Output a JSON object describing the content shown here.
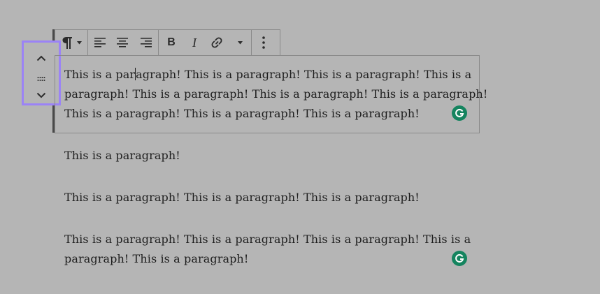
{
  "toolbar": {
    "paragraph_icon": "pilcrow-icon",
    "align_left": "align-left-icon",
    "align_center": "align-center-icon",
    "align_right": "align-right-icon",
    "bold_label": "B",
    "italic_label": "I",
    "link_icon": "link-icon",
    "more_rich_text": "chevron-down-icon",
    "more_options": "vertical-ellipsis-icon"
  },
  "mover": {
    "up_icon": "chevron-up-icon",
    "drag_icon": "drag-handle-icon",
    "down_icon": "chevron-down-icon",
    "highlight_color": "#9b83f6"
  },
  "blocks": {
    "selected": {
      "line1_before_caret": "This is a par",
      "line1_after_caret": "agraph! This is a paragraph! This is a paragraph! This is a",
      "line2": "paragraph! This is a paragraph! This is a paragraph! This is a paragraph!",
      "line3": "This is a paragraph! This is a paragraph! This is a paragraph!"
    },
    "second": "This is a paragraph!",
    "third": "This is a paragraph! This is a paragraph! This is a paragraph!",
    "fourth": {
      "line1": "This is a paragraph! This is a paragraph! This is a paragraph! This is a",
      "line2": "paragraph! This is a paragraph!"
    }
  },
  "grammarly": {
    "icon": "grammarly-icon",
    "letter": "G",
    "color": "#15845f"
  }
}
